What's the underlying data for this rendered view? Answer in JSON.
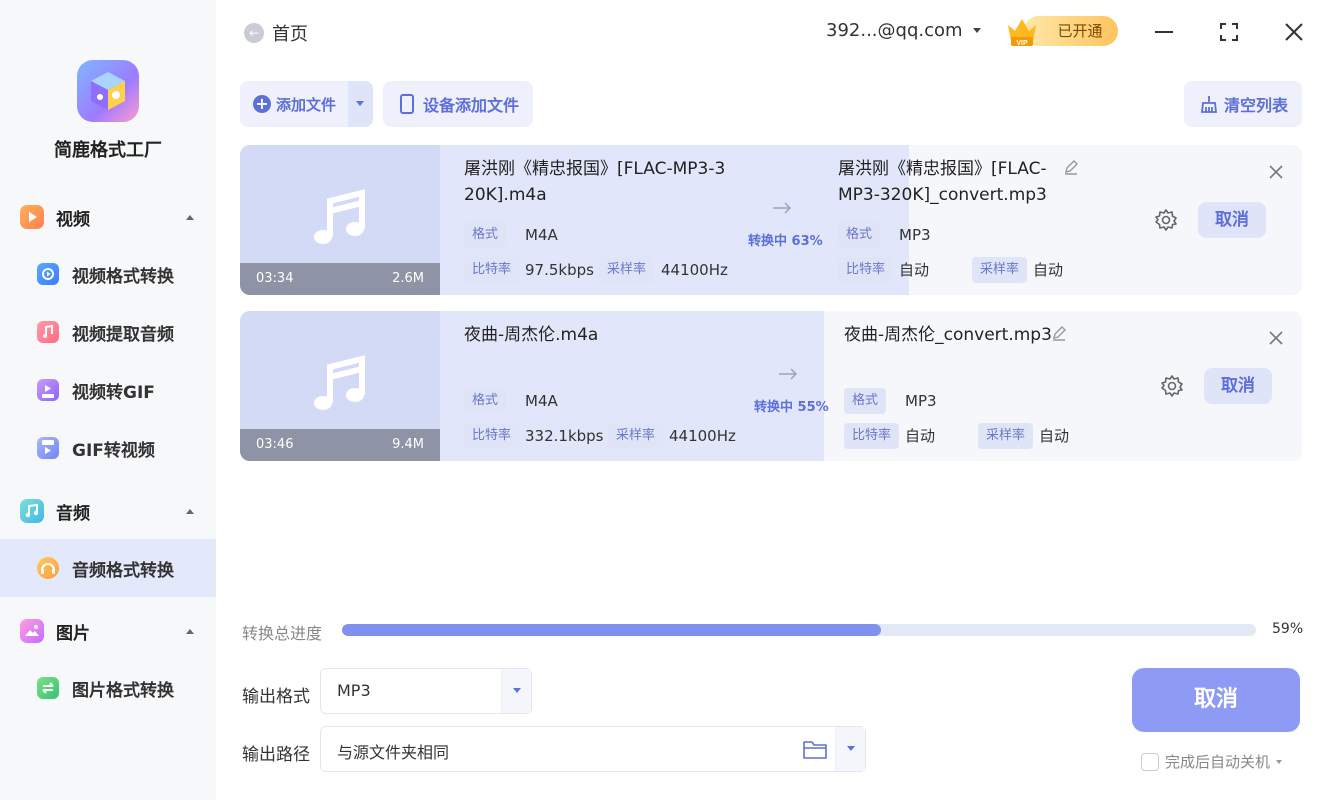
{
  "app": {
    "name": "简鹿格式工厂"
  },
  "sidebar": {
    "groups": [
      {
        "label": "视频",
        "icon": "video-icon",
        "items": [
          {
            "label": "视频格式转换",
            "icon": "video-convert-icon"
          },
          {
            "label": "视频提取音频",
            "icon": "extract-audio-icon"
          },
          {
            "label": "视频转GIF",
            "icon": "video-to-gif-icon"
          },
          {
            "label": "GIF转视频",
            "icon": "gif-to-video-icon"
          }
        ]
      },
      {
        "label": "音频",
        "icon": "audio-icon",
        "items": [
          {
            "label": "音频格式转换",
            "icon": "audio-convert-icon",
            "active": true
          }
        ]
      },
      {
        "label": "图片",
        "icon": "image-icon",
        "items": [
          {
            "label": "图片格式转换",
            "icon": "image-convert-icon"
          }
        ]
      }
    ]
  },
  "header": {
    "home_label": "首页",
    "account": "392...@qq.com",
    "vip_badge": "已开通"
  },
  "toolbar": {
    "add_file": "添加文件",
    "device_add": "设备添加文件",
    "clear_list": "清空列表"
  },
  "files": [
    {
      "duration": "03:34",
      "size": "2.6M",
      "source_name": "屠洪刚《精忠报国》[FLAC-MP3-320K].m4a",
      "source_name_line1": "屠洪刚《精忠报国》[FLAC-MP3-3",
      "source_name_line2": "20K].m4a",
      "source_format": "M4A",
      "source_bitrate": "97.5kbps",
      "source_samplerate": "44100Hz",
      "status": "转换中 63%",
      "progress": 0.63,
      "target_name_line1": "屠洪刚《精忠报国》[FLAC-",
      "target_name_line2": "MP3-320K]_convert.mp3",
      "target_format": "MP3",
      "target_bitrate": "自动",
      "target_samplerate": "自动",
      "cancel": "取消"
    },
    {
      "duration": "03:46",
      "size": "9.4M",
      "source_name_line1": "夜曲-周杰伦.m4a",
      "source_format": "M4A",
      "source_bitrate": "332.1kbps",
      "source_samplerate": "44100Hz",
      "status": "转换中 55%",
      "progress": 0.55,
      "target_name_line1": "夜曲-周杰伦_convert.mp3",
      "target_format": "MP3",
      "target_bitrate": "自动",
      "target_samplerate": "自动",
      "cancel": "取消"
    }
  ],
  "labels": {
    "format": "格式",
    "bitrate": "比特率",
    "samplerate": "采样率"
  },
  "bottom": {
    "total_label": "转换总进度",
    "total_progress": 0.59,
    "total_pct": "59%",
    "output_format_label": "输出格式",
    "output_format": "MP3",
    "output_path_label": "输出路径",
    "output_path": "与源文件夹相同",
    "cancel_all": "取消",
    "auto_shutdown": "完成后自动关机"
  },
  "colors": {
    "accent": "#5d6fd9",
    "progress_fill": "#7f90ef",
    "card_progress": "#e2e6fa",
    "active_sidebar": "#e3e8fb"
  }
}
